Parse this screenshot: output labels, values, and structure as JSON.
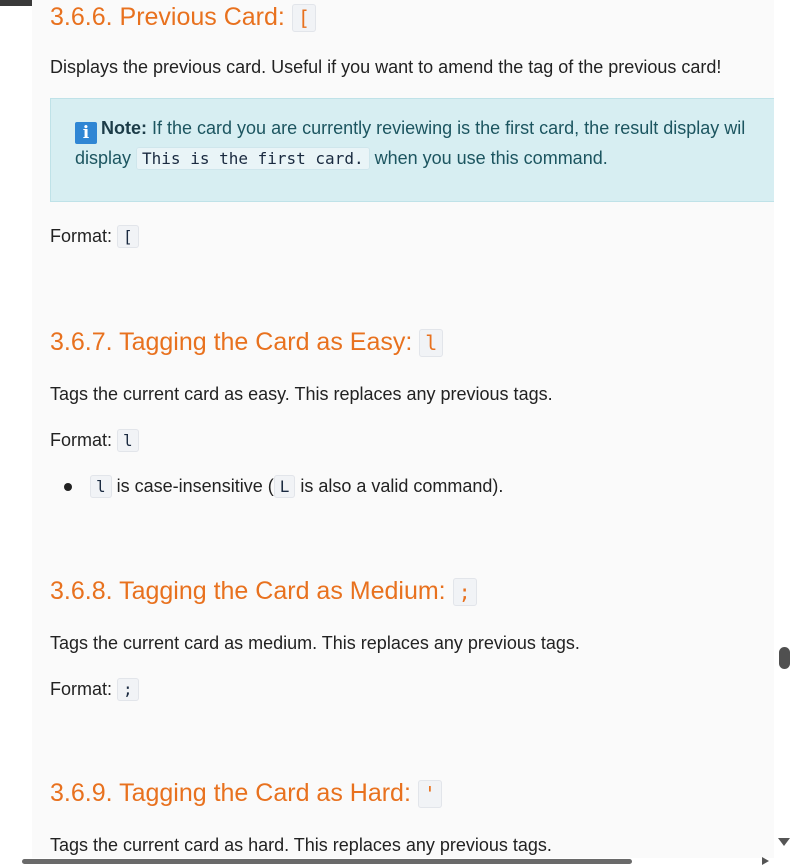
{
  "sections": {
    "prev": {
      "number": "3.6.6.",
      "title": "Previous Card:",
      "code": "[",
      "description": "Displays the previous card. Useful if you want to amend the tag of the previous card!",
      "note": {
        "label": "Note:",
        "text_before": " If the card you are currently reviewing is the first card, the result display wil",
        "text_line2_before": "display ",
        "code": "This is the first card.",
        "text_after": " when you use this command."
      },
      "format_label": "Format:",
      "format_code": "["
    },
    "easy": {
      "number": "3.6.7.",
      "title": "Tagging the Card as Easy:",
      "code": "l",
      "description": "Tags the current card as easy. This replaces any previous tags.",
      "format_label": "Format:",
      "format_code": "l",
      "bullet": {
        "code": "l",
        "text1": " is case-insensitive (",
        "code2": "L",
        "text2": " is also a valid command)."
      }
    },
    "medium": {
      "number": "3.6.8.",
      "title": "Tagging the Card as Medium:",
      "code": ";",
      "description": "Tags the current card as medium. This replaces any previous tags.",
      "format_label": "Format:",
      "format_code": ";"
    },
    "hard": {
      "number": "3.6.9.",
      "title": "Tagging the Card as Hard:",
      "code": "'",
      "description": "Tags the current card as hard. This replaces any previous tags."
    }
  },
  "icons": {
    "note_icon": "info-icon",
    "info_color": "#2f86d4",
    "heading_color": "#e8711e"
  }
}
